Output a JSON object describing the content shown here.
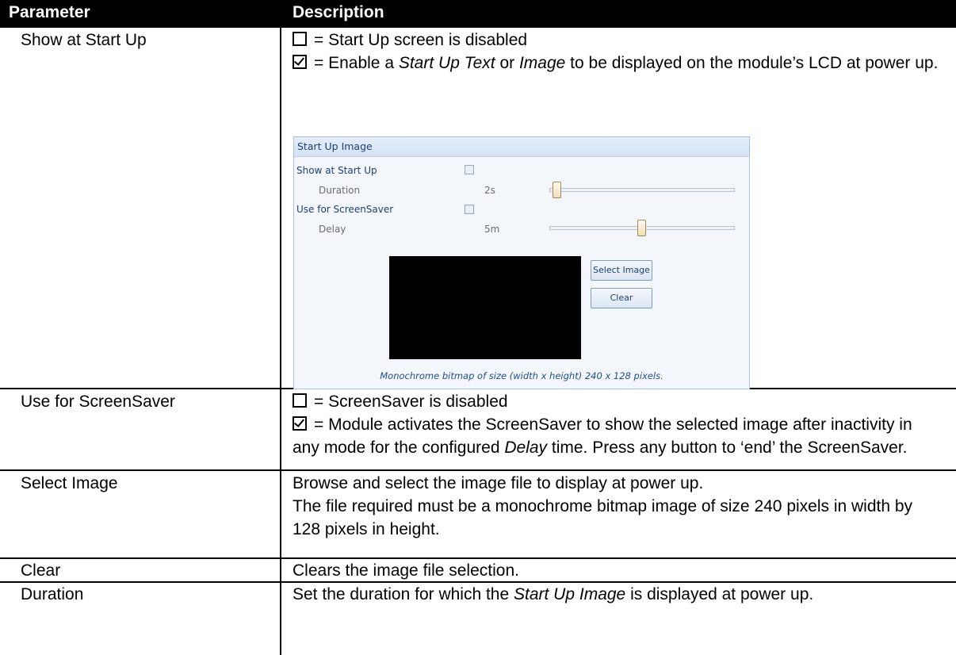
{
  "table": {
    "headers": [
      "Parameter",
      "Description"
    ],
    "rows": [
      {
        "param": "Show at Start Up",
        "desc": {
          "unchecked_text": "= Start Up screen is disabled",
          "checked_prefix": "= Enable a ",
          "checked_em1": "Start Up Text",
          "checked_mid": " or ",
          "checked_em2": "Image",
          "checked_suffix": " to be displayed on the module’s LCD at power up."
        }
      },
      {
        "param": "Use for ScreenSaver",
        "desc": {
          "unchecked_text": "= ScreenSaver is disabled",
          "checked_prefix": "= Module activates the ScreenSaver to show the selected image after inactivity in any mode for the configured ",
          "checked_em": "Delay",
          "checked_suffix": " time. Press any button to ‘end’ the ScreenSaver."
        }
      },
      {
        "param": "Select Image",
        "desc_lines": [
          "Browse and select the image file to display at power up.",
          "The file required must be a monochrome bitmap image of size 240 pixels in width by 128 pixels in height."
        ]
      },
      {
        "param": "Clear",
        "desc_lines": [
          "Clears the image file selection."
        ]
      },
      {
        "param": "Duration",
        "desc": {
          "prefix": "Set the duration for which the ",
          "em": "Start Up Image",
          "suffix": " is displayed at power up."
        }
      }
    ]
  },
  "panel": {
    "title": "Start Up Image",
    "show_at_startup_label": "Show at Start Up",
    "show_at_startup_checked": false,
    "duration_label": "Duration",
    "duration_value": "2s",
    "duration_level": 0.02,
    "use_for_screensaver_label": "Use for ScreenSaver",
    "use_for_screensaver_checked": false,
    "delay_label": "Delay",
    "delay_value": "5m",
    "delay_level": 0.5,
    "select_image_label": "Select Image",
    "clear_label": "Clear",
    "caption": "Monochrome bitmap of size (width x height) 240 x 128 pixels."
  }
}
